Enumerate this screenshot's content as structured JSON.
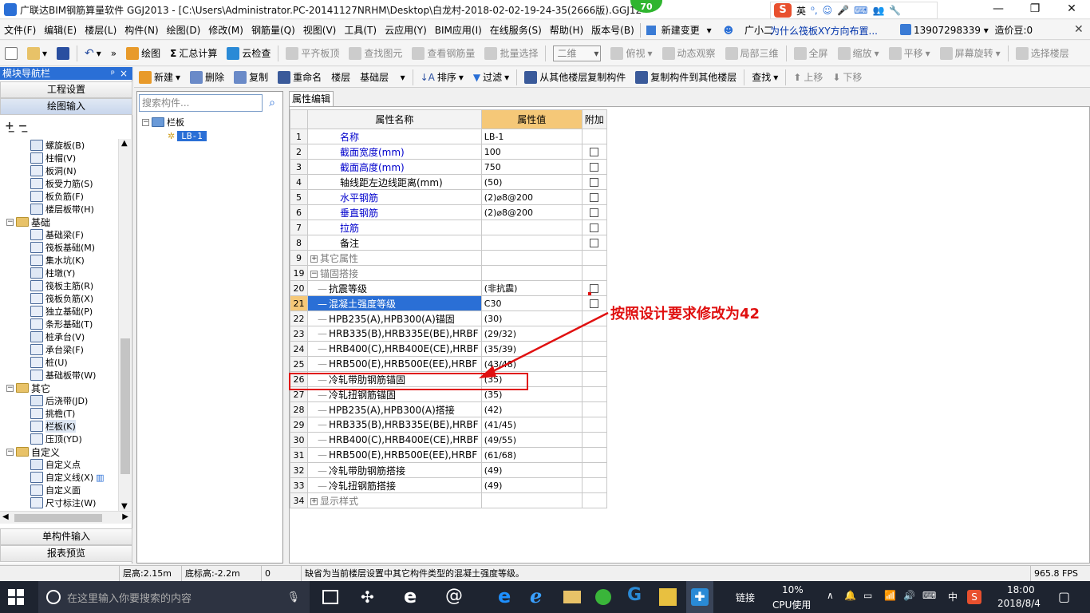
{
  "window": {
    "title": "广联达BIM钢筋算量软件 GGJ2013 - [C:\\Users\\Administrator.PC-20141127NRHM\\Desktop\\白龙村-2018-02-02-19-24-35(2666版).GGJ12",
    "badge": "70",
    "ime": "英",
    "controls": [
      "—",
      "❐",
      "✕"
    ]
  },
  "menubar": {
    "items": [
      "文件(F)",
      "编辑(E)",
      "楼层(L)",
      "构件(N)",
      "绘图(D)",
      "修改(M)",
      "钢筋量(Q)",
      "视图(V)",
      "工具(T)",
      "云应用(Y)",
      "BIM应用(I)",
      "在线服务(S)",
      "帮助(H)",
      "版本号(B)"
    ],
    "new_change": "新建变更",
    "assistant": "广小二",
    "question": "为什么筏板XY方向布置...",
    "phone": "13907298339",
    "coin": "造价豆:0"
  },
  "toolbar1": {
    "draw": "绘图",
    "sum": "汇总计算",
    "cloud_check": "云检查",
    "align_top": "平齐板顶",
    "find_elem": "查找图元",
    "view_rebar": "查看钢筋量",
    "batch_select": "批量选择",
    "view_mode": "二维",
    "top_view": "俯视",
    "dynamic": "动态观察",
    "local3d": "局部三维",
    "fullscreen": "全屏",
    "zoom": "缩放",
    "pan": "平移",
    "rotate": "屏幕旋转",
    "select_floor": "选择楼层"
  },
  "toolbar2": {
    "new": "新建",
    "delete": "删除",
    "copy": "复制",
    "rename": "重命名",
    "floor_label": "楼层",
    "floor": "基础层",
    "sort": "排序",
    "filter": "过滤",
    "copy_from": "从其他楼层复制构件",
    "copy_to": "复制构件到其他楼层",
    "find": "查找",
    "up": "上移",
    "down": "下移"
  },
  "nav": {
    "title": "模块导航栏",
    "pin": "ᵖ",
    "close": "×",
    "project_settings": "工程设置",
    "draw_input": "绘图输入",
    "single_input": "单构件输入",
    "report": "报表预览",
    "tree": [
      {
        "label": "螺旋板(B)",
        "level": 2
      },
      {
        "label": "柱帽(V)",
        "level": 2
      },
      {
        "label": "板洞(N)",
        "level": 2
      },
      {
        "label": "板受力筋(S)",
        "level": 2
      },
      {
        "label": "板负筋(F)",
        "level": 2
      },
      {
        "label": "楼层板带(H)",
        "level": 2
      },
      {
        "label": "基础",
        "level": 1
      },
      {
        "label": "基础梁(F)",
        "level": 2
      },
      {
        "label": "筏板基础(M)",
        "level": 2
      },
      {
        "label": "集水坑(K)",
        "level": 2
      },
      {
        "label": "柱墩(Y)",
        "level": 2
      },
      {
        "label": "筏板主筋(R)",
        "level": 2
      },
      {
        "label": "筏板负筋(X)",
        "level": 2
      },
      {
        "label": "独立基础(P)",
        "level": 2
      },
      {
        "label": "条形基础(T)",
        "level": 2
      },
      {
        "label": "桩承台(V)",
        "level": 2
      },
      {
        "label": "承台梁(F)",
        "level": 2
      },
      {
        "label": "桩(U)",
        "level": 2
      },
      {
        "label": "基础板带(W)",
        "level": 2
      },
      {
        "label": "其它",
        "level": 1
      },
      {
        "label": "后浇带(JD)",
        "level": 2
      },
      {
        "label": "挑檐(T)",
        "level": 2
      },
      {
        "label": "栏板(K)",
        "level": 2
      },
      {
        "label": "压顶(YD)",
        "level": 2
      },
      {
        "label": "自定义",
        "level": 1
      },
      {
        "label": "自定义点",
        "level": 2
      },
      {
        "label": "自定义线(X)",
        "level": 2
      },
      {
        "label": "自定义面",
        "level": 2
      },
      {
        "label": "尺寸标注(W)",
        "level": 2
      }
    ]
  },
  "components": {
    "search_placeholder": "搜索构件...",
    "root": "栏板",
    "child": "LB-1"
  },
  "props": {
    "tab": "属性编辑",
    "headers": [
      "属性名称",
      "属性值",
      "附加"
    ],
    "rows": [
      {
        "no": "1",
        "name": "名称",
        "value": "LB-1",
        "check": false,
        "blue": true
      },
      {
        "no": "2",
        "name": "截面宽度(mm)",
        "value": "100",
        "check": true,
        "blue": true
      },
      {
        "no": "3",
        "name": "截面高度(mm)",
        "value": "750",
        "check": true,
        "blue": true
      },
      {
        "no": "4",
        "name": "轴线距左边线距离(mm)",
        "value": "(50)",
        "check": true
      },
      {
        "no": "5",
        "name": "水平钢筋",
        "value": "(2)⌀8@200",
        "check": true,
        "blue": true
      },
      {
        "no": "6",
        "name": "垂直钢筋",
        "value": "(2)⌀8@200",
        "check": true,
        "blue": true
      },
      {
        "no": "7",
        "name": "拉筋",
        "value": "",
        "check": true,
        "blue": true
      },
      {
        "no": "8",
        "name": "备注",
        "value": "",
        "check": true
      },
      {
        "no": "9",
        "name": "其它属性",
        "value": "",
        "group": "+"
      },
      {
        "no": "19",
        "name": "锚固搭接",
        "value": "",
        "group": "−"
      },
      {
        "no": "20",
        "name": "抗震等级",
        "value": "(非抗震)",
        "check": true,
        "child": true
      },
      {
        "no": "21",
        "name": "混凝土强度等级",
        "value": "C30",
        "check": true,
        "child": true,
        "selected": true
      },
      {
        "no": "22",
        "name": "HPB235(A),HPB300(A)锚固",
        "value": "(30)",
        "child": true
      },
      {
        "no": "23",
        "name": "HRB335(B),HRB335E(BE),HRBF",
        "value": "(29/32)",
        "child": true
      },
      {
        "no": "24",
        "name": "HRB400(C),HRB400E(CE),HRBF",
        "value": "(35/39)",
        "child": true
      },
      {
        "no": "25",
        "name": "HRB500(E),HRB500E(EE),HRBF",
        "value": "(43/48)",
        "child": true
      },
      {
        "no": "26",
        "name": "冷轧带肋钢筋锚固",
        "value": "(35)",
        "child": true
      },
      {
        "no": "27",
        "name": "冷轧扭钢筋锚固",
        "value": "(35)",
        "child": true
      },
      {
        "no": "28",
        "name": "HPB235(A),HPB300(A)搭接",
        "value": "(42)",
        "child": true
      },
      {
        "no": "29",
        "name": "HRB335(B),HRB335E(BE),HRBF",
        "value": "(41/45)",
        "child": true
      },
      {
        "no": "30",
        "name": "HRB400(C),HRB400E(CE),HRBF",
        "value": "(49/55)",
        "child": true
      },
      {
        "no": "31",
        "name": "HRB500(E),HRB500E(EE),HRBF",
        "value": "(61/68)",
        "child": true
      },
      {
        "no": "32",
        "name": "冷轧带肋钢筋搭接",
        "value": "(49)",
        "child": true
      },
      {
        "no": "33",
        "name": "冷轧扭钢筋搭接",
        "value": "(49)",
        "child": true
      },
      {
        "no": "34",
        "name": "显示样式",
        "value": "",
        "group": "+"
      }
    ]
  },
  "annotation": {
    "text": "按照设计要求修改为42"
  },
  "status": {
    "floor_height": "层高:2.15m",
    "base_height": "底标高:-2.2m",
    "zero": "0",
    "message": "缺省为当前楼层设置中其它构件类型的混凝土强度等级。",
    "fps": "965.8 FPS"
  },
  "taskbar": {
    "search_placeholder": "在这里输入你要搜索的内容",
    "link": "链接",
    "cpu_percent": "10%",
    "cpu_label": "CPU使用",
    "lang": "中",
    "time": "18:00",
    "date": "2018/8/4"
  }
}
